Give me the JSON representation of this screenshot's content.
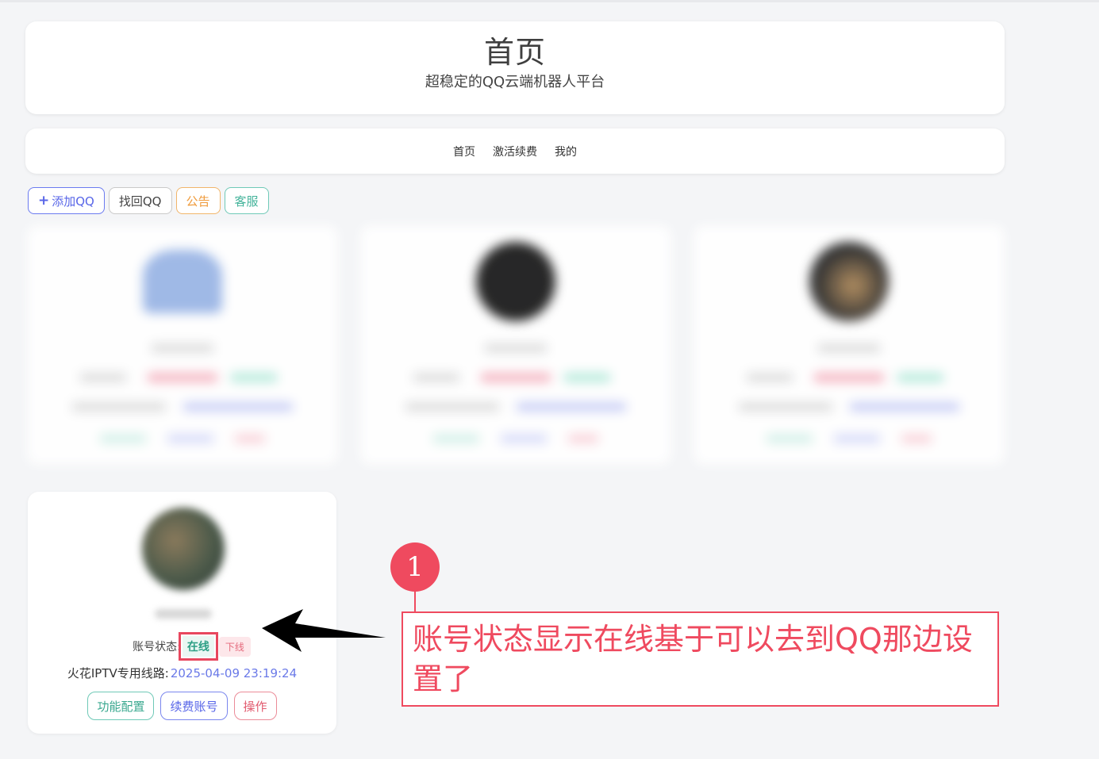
{
  "header": {
    "title": "首页",
    "subtitle": "超稳定的QQ云端机器人平台"
  },
  "nav": {
    "items": [
      "首页",
      "激活续费",
      "我的"
    ]
  },
  "toolbar": {
    "add_label": "添加QQ",
    "find_label": "找回QQ",
    "notice_label": "公告",
    "service_label": "客服"
  },
  "account_card": {
    "status_label": "账号状态:",
    "online_label": "在线",
    "offline_label": "下线",
    "route_label": "火花IPTV专用线路:",
    "expire_date": "2025-04-09 23:19:24",
    "buttons": {
      "config": "功能配置",
      "renew": "续费账号",
      "operate": "操作"
    }
  },
  "annotation": {
    "number": "1",
    "text": "账号状态显示在线基于可以去到QQ那边设置了"
  },
  "colors": {
    "accent_blue": "#5866e8",
    "accent_green": "#43b39a",
    "accent_orange": "#ef9a3a",
    "annotation_red": "#ef4a5f"
  }
}
